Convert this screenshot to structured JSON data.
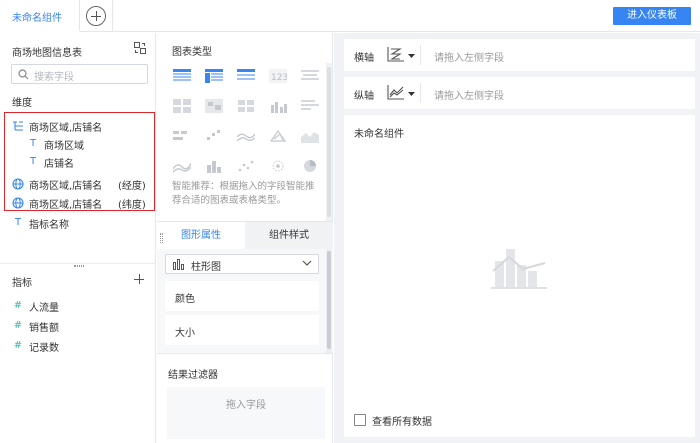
{
  "topbar": {
    "tab_label": "未命名组件",
    "enter_button": "进入仪表板"
  },
  "left": {
    "dataset_title": "商场地图信息表",
    "search_placeholder": "搜索字段",
    "dimension_label": "维度",
    "dimensions": [
      {
        "icon": "tree-icon",
        "label": "商场区域,店铺名",
        "suffix": ""
      },
      {
        "icon": "text-icon",
        "label": "商场区域",
        "suffix": ""
      },
      {
        "icon": "text-icon",
        "label": "店铺名",
        "suffix": ""
      },
      {
        "icon": "globe-icon",
        "label": "商场区域,店铺名",
        "suffix": "(经度)"
      },
      {
        "icon": "globe-icon",
        "label": "商场区域,店铺名",
        "suffix": "(纬度)"
      },
      {
        "icon": "text-icon",
        "label": "指标名称",
        "suffix": ""
      }
    ],
    "measure_label": "指标",
    "measures": [
      {
        "icon": "hash-icon",
        "label": "人流量"
      },
      {
        "icon": "hash-icon",
        "label": "销售额"
      },
      {
        "icon": "hash-icon",
        "label": "记录数"
      }
    ]
  },
  "middle": {
    "chart_type_title": "图表类型",
    "smart_tip": "智能推荐：根据拖入的字段智能推荐合适的图表或表格类型。",
    "tab_graph": "图形属性",
    "tab_style": "组件样式",
    "chart_select": "柱形图",
    "props": [
      "颜色",
      "大小"
    ],
    "filter_title": "结果过滤器",
    "filter_drop": "拖入字段"
  },
  "right": {
    "x_axis_label": "横轴",
    "x_axis_placeholder": "请拖入左侧字段",
    "y_axis_label": "纵轴",
    "y_axis_placeholder": "请拖入左侧字段",
    "canvas_title": "未命名组件",
    "view_all_label": "查看所有数据"
  },
  "colors": {
    "accent": "#3685f2",
    "highlight_border": "#e0262b"
  }
}
